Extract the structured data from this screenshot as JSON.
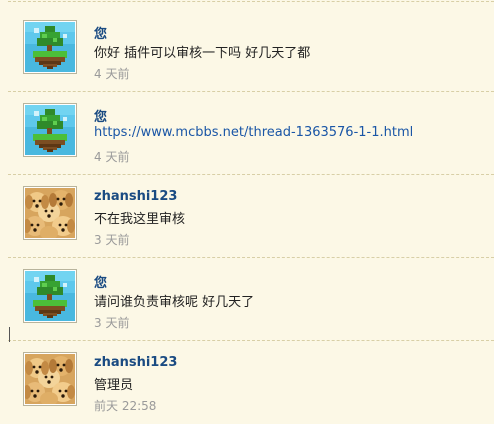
{
  "messages": [
    {
      "author": "您",
      "avatar": "pixel-island-tree-icon",
      "text": "你好  插件可以审核一下吗  好几天了都",
      "time": "4 天前"
    },
    {
      "author": "您",
      "avatar": "pixel-island-tree-icon",
      "text": "https://www.mcbbs.net/thread-1363576-1-1.html",
      "time": "4 天前"
    },
    {
      "author": "zhanshi123",
      "avatar": "golden-retriever-puppies-photo",
      "text": "不在我这里审核",
      "time": "3 天前"
    },
    {
      "author": "您",
      "avatar": "pixel-island-tree-icon",
      "text": "请问谁负责审核呢  好几天了",
      "time": "3 天前"
    },
    {
      "author": "zhanshi123",
      "avatar": "golden-retriever-puppies-photo",
      "text": "管理员",
      "time": "前天 22:58"
    }
  ],
  "colors": {
    "background": "#fcf8e6",
    "author": "#1a4b82",
    "link": "#1a56a6",
    "time": "#9a9a9a"
  }
}
